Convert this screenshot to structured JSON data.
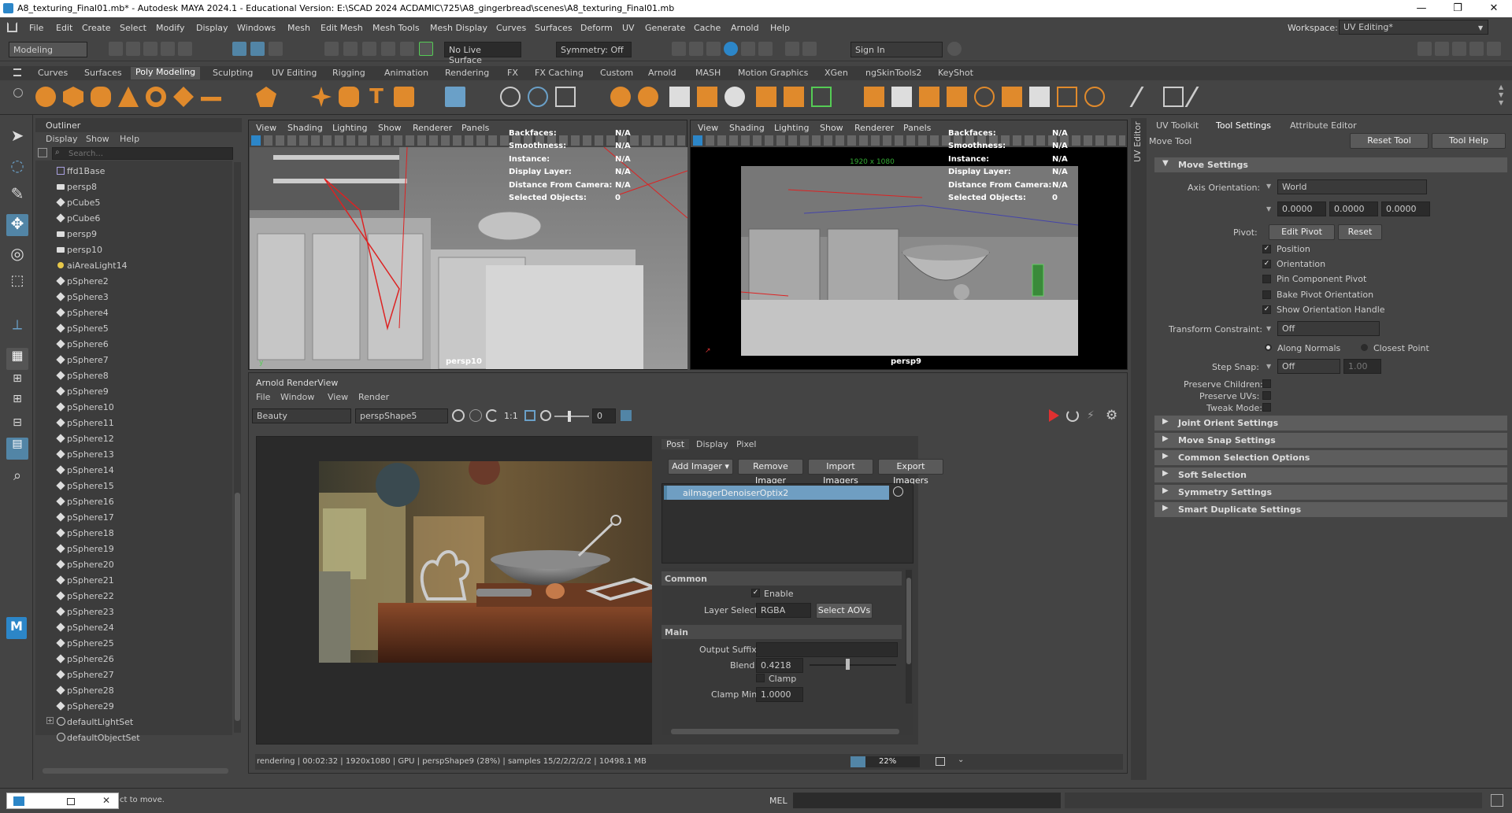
{
  "window": {
    "title": "A8_texturing_Final01.mb* - Autodesk MAYA 2024.1 - Educational Version: E:\\SCAD 2024 ACDAMIC\\725\\A8_gingerbread\\scenes\\A8_texturing_Final01.mb",
    "minimize": "—",
    "maximize": "❐",
    "close": "✕"
  },
  "menu": [
    "File",
    "Edit",
    "Create",
    "Select",
    "Modify",
    "Display",
    "Windows",
    "Mesh",
    "Edit Mesh",
    "Mesh Tools",
    "Mesh Display",
    "Curves",
    "Surfaces",
    "Deform",
    "UV",
    "Generate",
    "Cache",
    "Arnold",
    "Help"
  ],
  "workspace": {
    "label": "Workspace:",
    "value": "UV Editing*"
  },
  "statusline": {
    "mode": "Modeling",
    "live_surface": "No Live Surface",
    "symmetry": "Symmetry: Off",
    "sign_in": "Sign In"
  },
  "shelf_tabs": [
    "Curves",
    "Surfaces",
    "Poly Modeling",
    "Sculpting",
    "UV Editing",
    "Rigging",
    "Animation",
    "Rendering",
    "FX",
    "FX Caching",
    "Custom",
    "Arnold",
    "MASH",
    "Motion Graphics",
    "XGen",
    "ngSkinTools2",
    "KeyShot"
  ],
  "shelf_active": "Poly Modeling",
  "outliner": {
    "title": "Outliner",
    "menus": [
      "Display",
      "Show",
      "Help"
    ],
    "search_placeholder": "Search...",
    "items": [
      "ffd1Base",
      "persp8",
      "pCube5",
      "pCube6",
      "persp9",
      "persp10",
      "aiAreaLight14",
      "pSphere2",
      "pSphere3",
      "pSphere4",
      "pSphere5",
      "pSphere6",
      "pSphere7",
      "pSphere8",
      "pSphere9",
      "pSphere10",
      "pSphere11",
      "pSphere12",
      "pSphere13",
      "pSphere14",
      "pSphere15",
      "pSphere16",
      "pSphere17",
      "pSphere18",
      "pSphere19",
      "pSphere20",
      "pSphere21",
      "pSphere22",
      "pSphere23",
      "pSphere24",
      "pSphere25",
      "pSphere26",
      "pSphere27",
      "pSphere28",
      "pSphere29",
      "defaultLightSet",
      "defaultObjectSet"
    ]
  },
  "viewport_menus": [
    "View",
    "Shading",
    "Lighting",
    "Show",
    "Renderer",
    "Panels"
  ],
  "viewport_left": {
    "camera": "persp10",
    "hud": [
      [
        "Backfaces:",
        "N/A"
      ],
      [
        "Smoothness:",
        "N/A"
      ],
      [
        "Instance:",
        "N/A"
      ],
      [
        "Display Layer:",
        "N/A"
      ],
      [
        "Distance From Camera:",
        "N/A"
      ],
      [
        "Selected Objects:",
        "0"
      ]
    ]
  },
  "viewport_right": {
    "camera": "persp9",
    "resolution": "1920 x 1080",
    "hud": [
      [
        "Backfaces:",
        "N/A"
      ],
      [
        "Smoothness:",
        "N/A"
      ],
      [
        "Instance:",
        "N/A"
      ],
      [
        "Display Layer:",
        "N/A"
      ],
      [
        "Distance From Camera:",
        "N/A"
      ],
      [
        "Selected Objects:",
        "0"
      ]
    ]
  },
  "renderview": {
    "title": "Arnold RenderView",
    "menus": [
      "File",
      "Window",
      "View",
      "Render"
    ],
    "aov": "Beauty",
    "camera": "perspShape5",
    "ratio": "1:1",
    "exposure": "0",
    "tabs": [
      "Post",
      "Display",
      "Pixel"
    ],
    "buttons": {
      "add": "Add Imager ▾",
      "remove": "Remove Imager",
      "import": "Import Imagers",
      "export": "Export Imagers"
    },
    "imager": "aiImagerDenoiserOptix2",
    "common": {
      "label": "Common",
      "enable": "Enable",
      "layer_selection_label": "Layer Selection",
      "layer_selection_value": "RGBA",
      "select_aovs": "Select AOVs"
    },
    "main": {
      "label": "Main",
      "output_suffix_label": "Output Suffix",
      "blend_label": "Blend",
      "blend_value": "0.4218",
      "blend_fraction": 0.4218,
      "clamp_label": "Clamp",
      "clamp_min_label": "Clamp Min",
      "clamp_min_value": "1.0000"
    },
    "status": "rendering | 00:02:32 | 1920x1080 | GPU | perspShape9 (28%) | samples 15/2/2/2/2/2 | 10498.1 MB",
    "progress_text": "22%",
    "progress_fraction": 0.22
  },
  "tool_settings": {
    "tabs": [
      "UV Toolkit",
      "Tool Settings",
      "Attribute Editor"
    ],
    "tool_name": "Move Tool",
    "reset_tool": "Reset Tool",
    "tool_help": "Tool Help",
    "section_move": "Move Settings",
    "axis_orientation_label": "Axis Orientation:",
    "axis_orientation_value": "World",
    "axis_values": [
      "0.0000",
      "0.0000",
      "0.0000"
    ],
    "pivot_label": "Pivot:",
    "edit_pivot": "Edit Pivot",
    "reset": "Reset",
    "pivot_checks": [
      {
        "label": "Position",
        "checked": true
      },
      {
        "label": "Orientation",
        "checked": true
      },
      {
        "label": "Pin Component Pivot",
        "checked": false
      },
      {
        "label": "Bake Pivot Orientation",
        "checked": false
      },
      {
        "label": "Show Orientation Handle",
        "checked": true
      }
    ],
    "transform_constraint_label": "Transform Constraint:",
    "transform_constraint_value": "Off",
    "along_normals": "Along Normals",
    "closest_point": "Closest Point",
    "step_snap_label": "Step Snap:",
    "step_snap_value": "Off",
    "step_snap_amount": "1.00",
    "preserve_children": "Preserve Children:",
    "preserve_uvs": "Preserve UVs:",
    "tweak_mode": "Tweak Mode:",
    "sections": [
      "Joint Orient Settings",
      "Move Snap Settings",
      "Common Selection Options",
      "Soft Selection",
      "Symmetry Settings",
      "Smart Duplicate Settings"
    ],
    "side_label": "UV Editor"
  },
  "helpline": {
    "text": "ct to move.",
    "mel": "MEL"
  },
  "colors": {
    "accent": "#5285a6",
    "imager_highlight": "#6f9ec2",
    "render_red": "#e03030"
  }
}
